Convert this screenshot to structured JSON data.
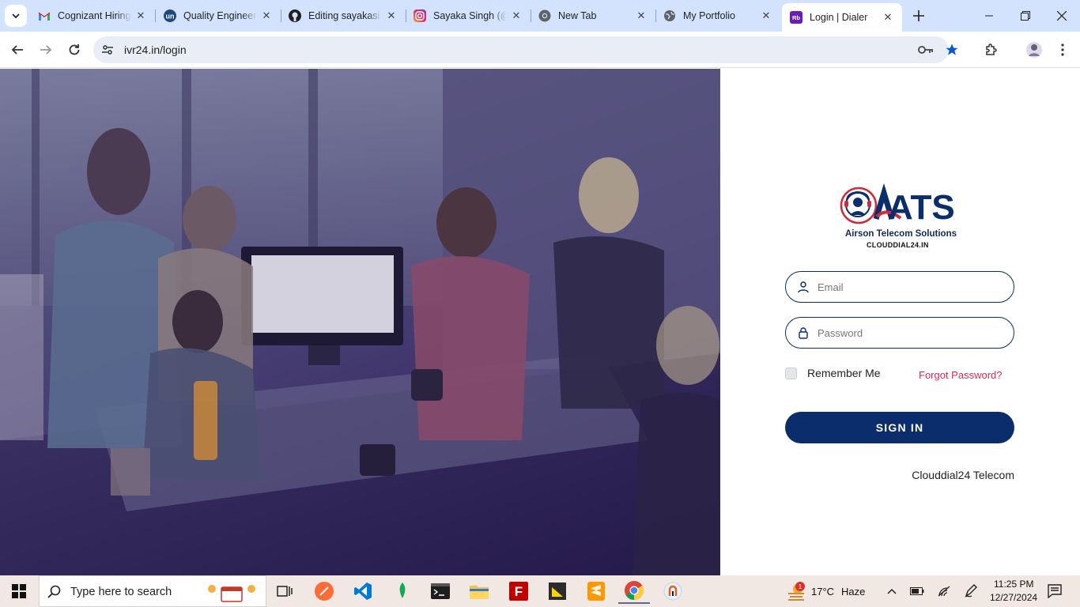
{
  "browser": {
    "tabs": [
      {
        "title": "Cognizant Hiring",
        "icon": "gmail-icon"
      },
      {
        "title": "Quality Engineer",
        "icon": "unstop-icon"
      },
      {
        "title": "Editing sayakasi",
        "icon": "github-icon"
      },
      {
        "title": "Sayaka Singh (@",
        "icon": "instagram-icon"
      },
      {
        "title": "New Tab",
        "icon": "chrome-icon"
      },
      {
        "title": "My Portfolio",
        "icon": "globe-icon"
      },
      {
        "title": "Login | Dialer",
        "icon": "dialer-icon",
        "active": true
      }
    ],
    "url": "ivr24.in/login"
  },
  "login": {
    "logo_text": "ATS",
    "company_name": "Airson Telecom Solutions",
    "company_url": "CLOUDDIAL24.IN",
    "email_placeholder": "Email",
    "password_placeholder": "Password",
    "remember_label": "Remember Me",
    "forgot_label": "Forgot Password?",
    "signin_label": "SIGN IN",
    "footer_brand": "Clouddial24 Telecom"
  },
  "taskbar": {
    "search_placeholder": "Type here to search",
    "weather_temp": "17°C",
    "weather_desc": "Haze",
    "weather_badge": "1",
    "time": "11:25 PM",
    "date": "12/27/2024"
  },
  "colors": {
    "brand_navy": "#0c2d6b",
    "forgot_red": "#e0294f",
    "chrome_blue": "#d3e3fd"
  }
}
